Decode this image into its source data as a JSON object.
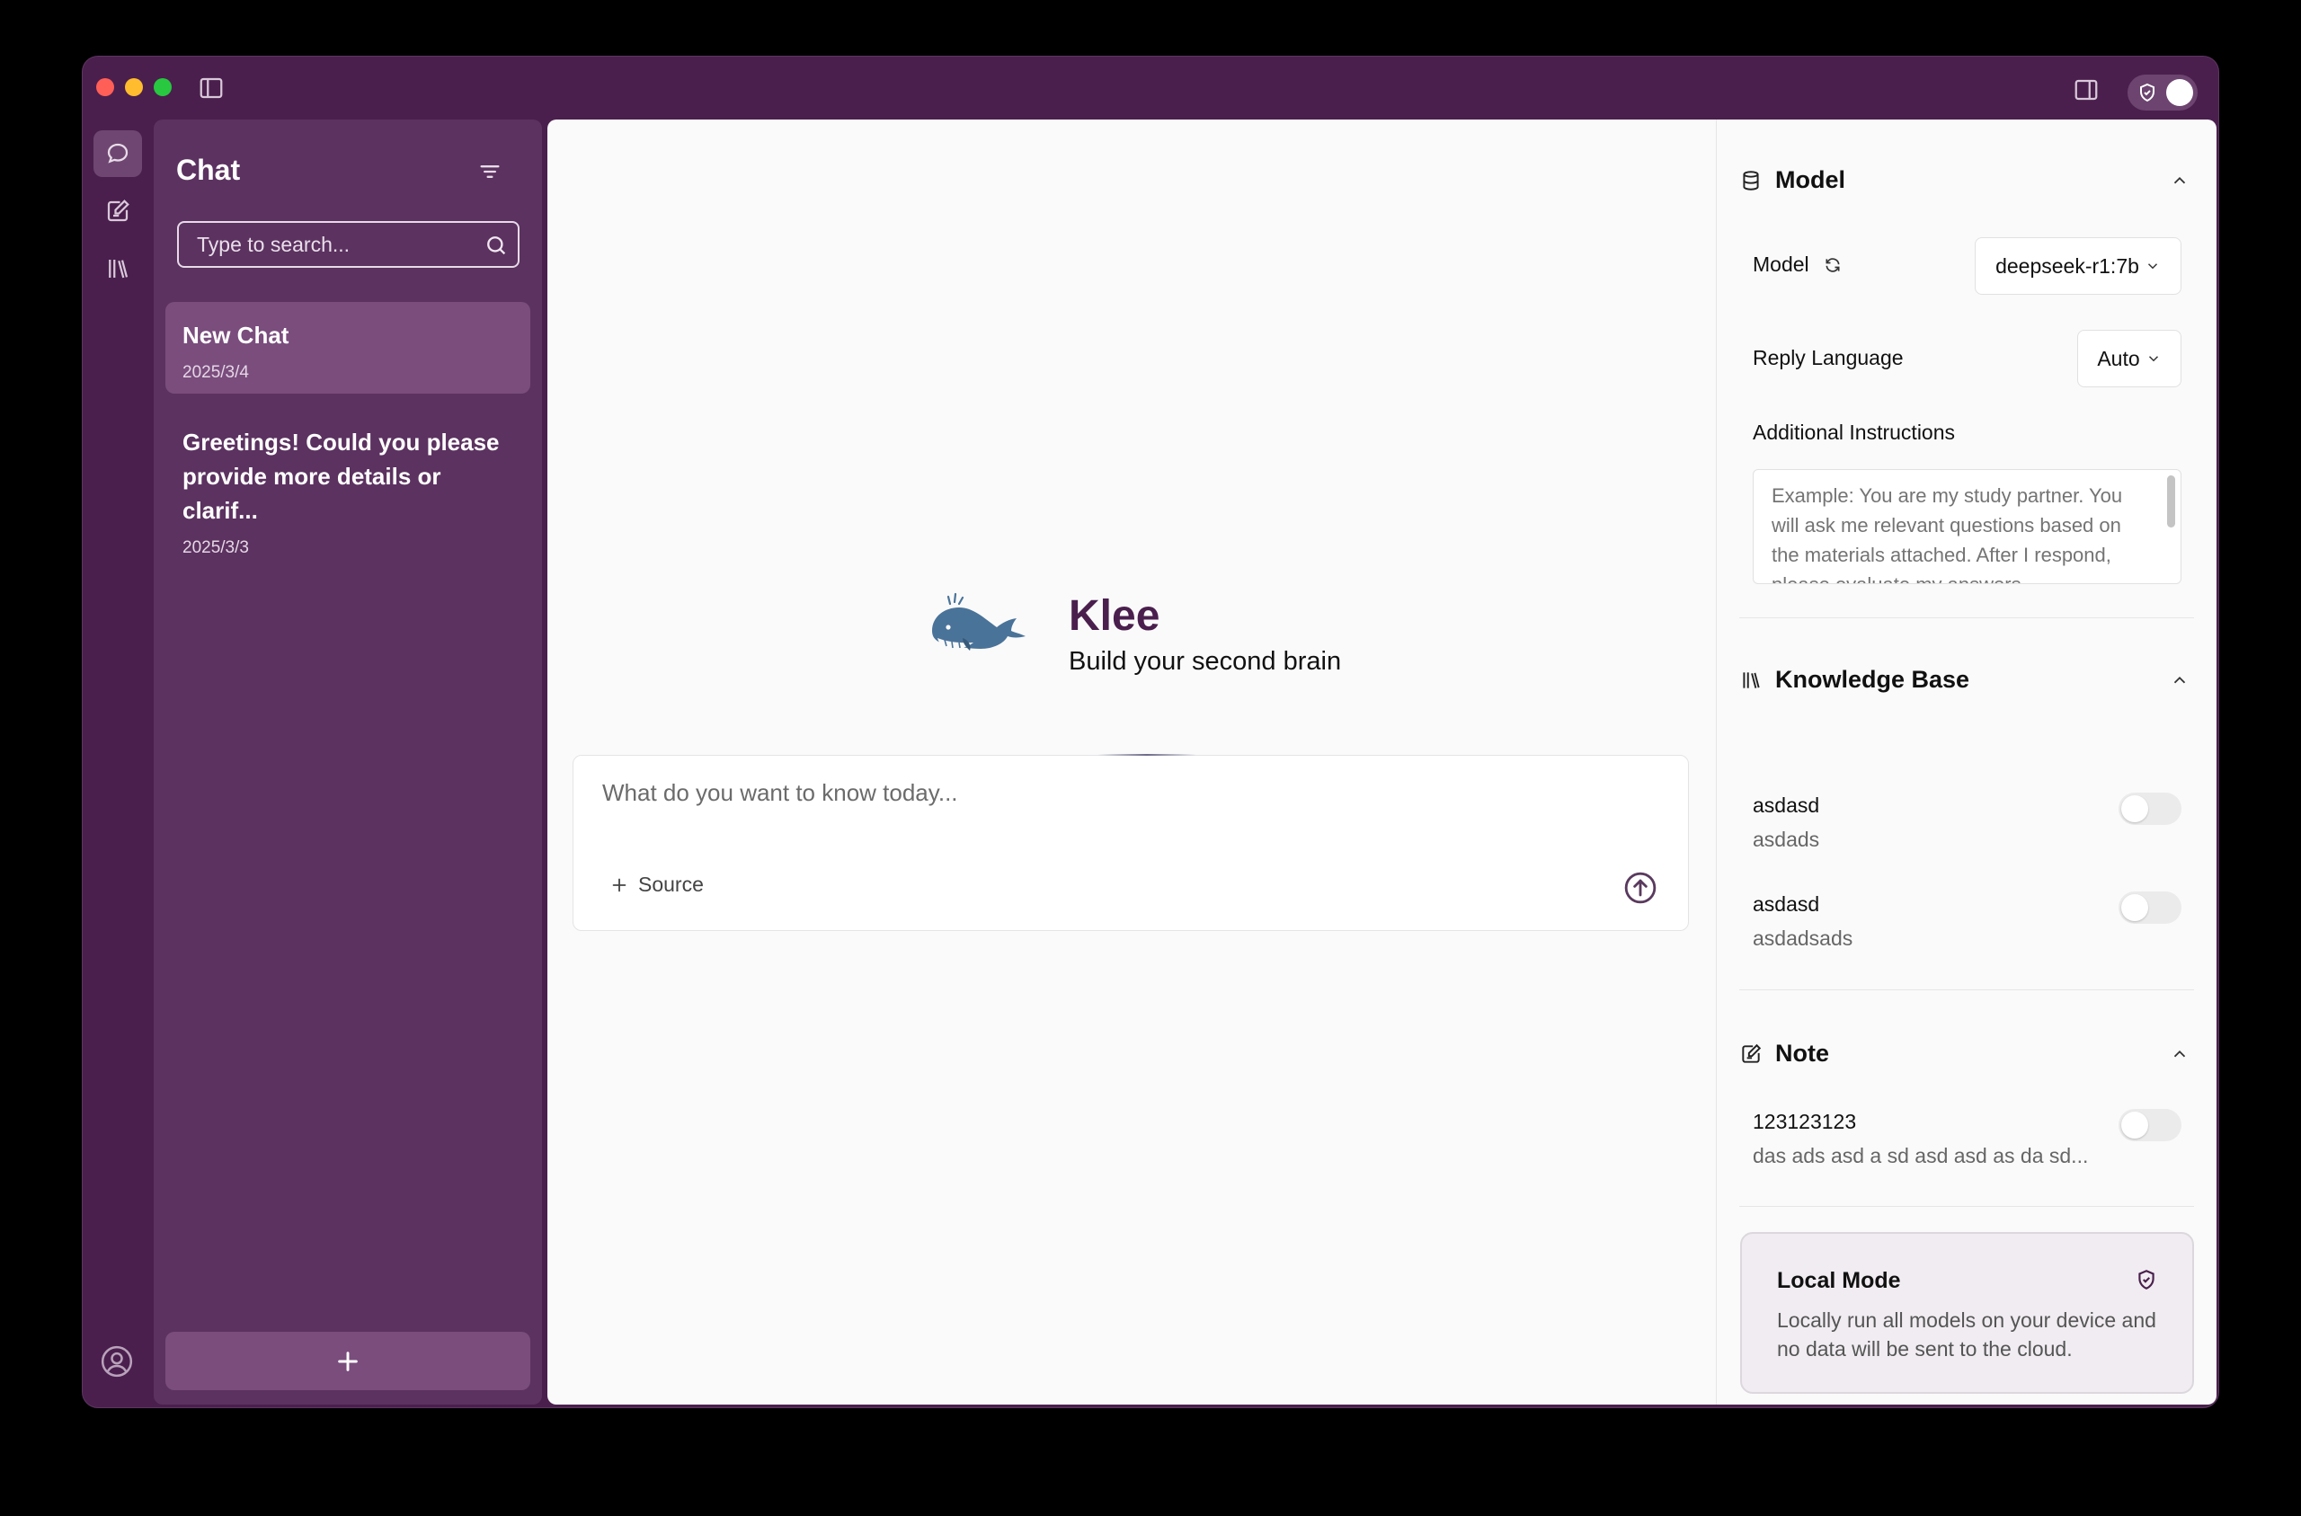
{
  "chat_panel": {
    "title": "Chat",
    "search_placeholder": "Type to search...",
    "items": [
      {
        "title": "New Chat",
        "date": "2025/3/4"
      },
      {
        "title": "Greetings! Could you please provide more details or clarif...",
        "date": "2025/3/3"
      }
    ]
  },
  "main": {
    "brand": "Klee",
    "tagline": "Build your second brain",
    "input_placeholder": "What do you want to know today...",
    "source_label": "Source"
  },
  "right_panel": {
    "model_section": {
      "title": "Model",
      "model_label": "Model",
      "model_value": "deepseek-r1:7b",
      "language_label": "Reply Language",
      "language_value": "Auto",
      "instructions_label": "Additional Instructions",
      "instructions_placeholder": "Example: You are my study partner. You will ask me relevant questions based on the materials attached. After I respond, please evaluate my answers."
    },
    "knowledge_section": {
      "title": "Knowledge Base",
      "items": [
        {
          "title": "asdasd",
          "subtitle": "asdads"
        },
        {
          "title": "asdasd",
          "subtitle": "asdadsads"
        }
      ]
    },
    "note_section": {
      "title": "Note",
      "items": [
        {
          "title": "123123123",
          "subtitle": "das ads asd a sd asd asd as da sd..."
        }
      ]
    },
    "local_mode": {
      "title": "Local Mode",
      "description": "Locally run all models on your device and no data will be sent to the cloud."
    }
  },
  "colors": {
    "window_bg": "#4a1f4d",
    "panel_bg": "#5c3260",
    "active_item": "#7a4d7d",
    "brand": "#4a1f4d",
    "whale": "#4a7399"
  }
}
